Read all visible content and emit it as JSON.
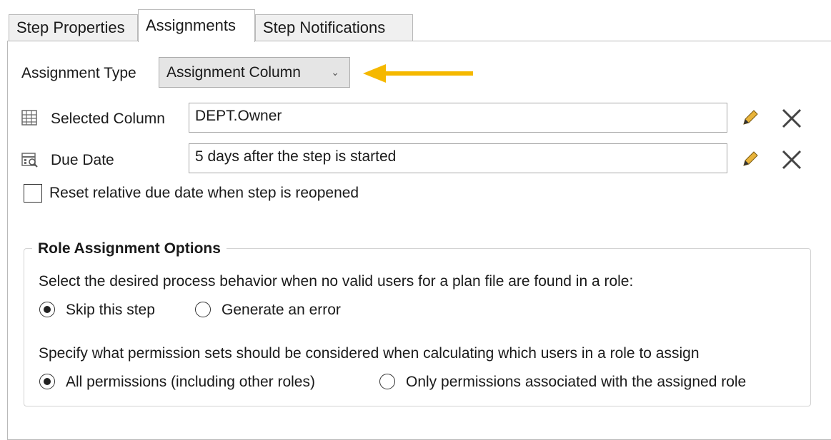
{
  "tabs": [
    {
      "label": "Step Properties",
      "active": false
    },
    {
      "label": "Assignments",
      "active": true
    },
    {
      "label": "Step Notifications",
      "active": false
    }
  ],
  "assignment_type": {
    "label": "Assignment Type",
    "selected": "Assignment Column",
    "icon": "chevron-down-icon"
  },
  "annotation_arrow_color": "#f5b800",
  "selected_column": {
    "label": "Selected Column",
    "value": "DEPT.Owner",
    "icon": "table-grid-icon"
  },
  "due_date": {
    "label": "Due Date",
    "value": "5 days after the step is started",
    "icon": "calendar-search-icon"
  },
  "reset_checkbox": {
    "label": "Reset relative due date when step is reopened",
    "checked": false
  },
  "role_options": {
    "title": "Role Assignment Options",
    "no_users_prompt": "Select the desired process behavior when no valid users for a plan file are found in a role:",
    "no_users_choices": [
      {
        "label": "Skip this step",
        "selected": true
      },
      {
        "label": "Generate an error",
        "selected": false
      }
    ],
    "permissions_prompt": "Specify what permission sets should be considered when calculating which users in a role to assign",
    "permissions_choices": [
      {
        "label": "All permissions (including other roles)",
        "selected": true
      },
      {
        "label": "Only permissions associated with the assigned role",
        "selected": false
      }
    ]
  }
}
